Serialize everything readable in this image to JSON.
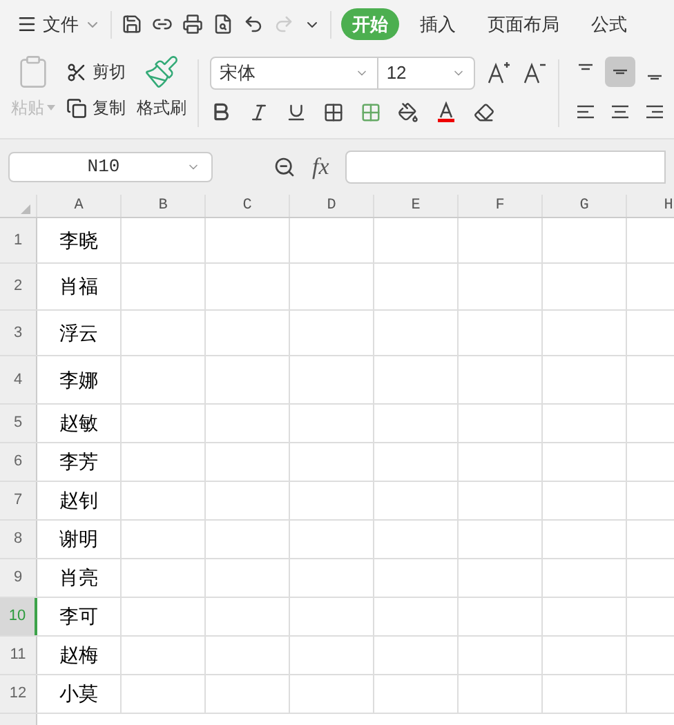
{
  "top_bar": {
    "file_menu": "文件",
    "tabs": [
      {
        "label": "开始",
        "selected": true
      },
      {
        "label": "插入",
        "selected": false
      },
      {
        "label": "页面布局",
        "selected": false
      },
      {
        "label": "公式",
        "selected": false
      }
    ],
    "redo_disabled": true
  },
  "ribbon": {
    "paste": {
      "label": "粘贴",
      "disabled": true
    },
    "cut": "剪切",
    "copy": "复制",
    "format_painter": "格式刷",
    "font_name": "宋体",
    "font_size": "12",
    "align_buttons": [
      {
        "kind": "top",
        "selected": false
      },
      {
        "kind": "middle",
        "selected": true
      },
      {
        "kind": "bottom",
        "selected": false
      },
      {
        "kind": "left",
        "selected": false
      },
      {
        "kind": "center",
        "selected": false
      },
      {
        "kind": "right",
        "selected": false
      }
    ]
  },
  "formula_bar": {
    "name_box": "N10",
    "fx": "fx"
  },
  "sheet": {
    "columns": [
      "A",
      "B",
      "C",
      "D",
      "E",
      "F",
      "G",
      "H"
    ],
    "rows": [
      {
        "number": "1",
        "name": "李晓",
        "selected": false
      },
      {
        "number": "2",
        "name": "肖福",
        "selected": false
      },
      {
        "number": "3",
        "name": "浮云",
        "selected": false
      },
      {
        "number": "4",
        "name": "李娜",
        "selected": false
      },
      {
        "number": "5",
        "name": "赵敏",
        "selected": false
      },
      {
        "number": "6",
        "name": "李芳",
        "selected": false
      },
      {
        "number": "7",
        "name": "赵钊",
        "selected": false
      },
      {
        "number": "8",
        "name": "谢明",
        "selected": false
      },
      {
        "number": "9",
        "name": "肖亮",
        "selected": false
      },
      {
        "number": "10",
        "name": "李可",
        "selected": true
      },
      {
        "number": "11",
        "name": "赵梅",
        "selected": false
      },
      {
        "number": "12",
        "name": "小莫",
        "selected": false
      }
    ]
  }
}
